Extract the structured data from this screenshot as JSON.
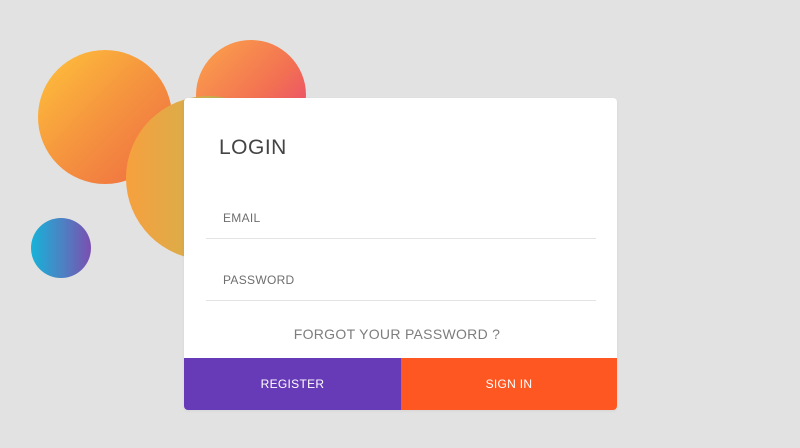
{
  "login": {
    "title": "LOGIN",
    "email": {
      "placeholder": "EMAIL",
      "value": ""
    },
    "password": {
      "placeholder": "PASSWORD",
      "value": ""
    },
    "forgot_link": "FORGOT YOUR PASSWORD ?",
    "register_label": "REGISTER",
    "signin_label": "SIGN IN"
  },
  "colors": {
    "background": "#e2e2e2",
    "card": "#ffffff",
    "register": "#673ab7",
    "signin": "#ff5722",
    "title_text": "#444444",
    "muted_text": "#7d7d7d"
  }
}
